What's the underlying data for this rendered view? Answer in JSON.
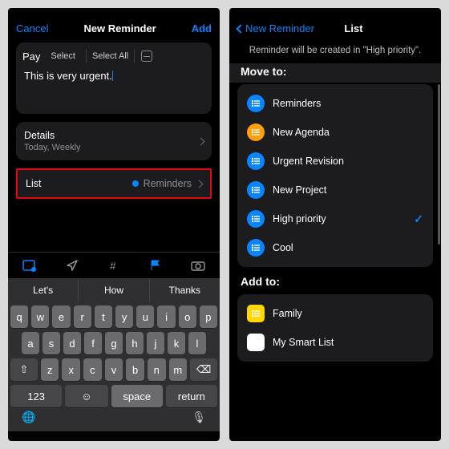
{
  "left": {
    "nav": {
      "cancel": "Cancel",
      "title": "New Reminder",
      "add": "Add"
    },
    "title_value": "Pay",
    "select": "Select",
    "select_all": "Select All",
    "body": "This is very urgent.",
    "details": {
      "label": "Details",
      "sub": "Today, Weekly"
    },
    "list": {
      "label": "List",
      "value": "Reminders"
    },
    "suggestions": [
      "Let's",
      "How",
      "Thanks"
    ],
    "rows": {
      "r1": [
        "q",
        "w",
        "e",
        "r",
        "t",
        "y",
        "u",
        "i",
        "o",
        "p"
      ],
      "r2": [
        "a",
        "s",
        "d",
        "f",
        "g",
        "h",
        "j",
        "k",
        "l"
      ],
      "r3": [
        "z",
        "x",
        "c",
        "v",
        "b",
        "n",
        "m"
      ]
    },
    "num_key": "123",
    "space": "space",
    "return": "return"
  },
  "right": {
    "back": "New Reminder",
    "title": "List",
    "info": "Reminder will be created in \"High priority\".",
    "move_h": "Move to:",
    "add_h": "Add to:",
    "move": [
      {
        "name": "Reminders",
        "color": "#0a84ff",
        "selected": false
      },
      {
        "name": "New Agenda",
        "color": "#ff9f0a",
        "selected": false
      },
      {
        "name": "Urgent Revision",
        "color": "#0a84ff",
        "selected": false
      },
      {
        "name": "New Project",
        "color": "#0a84ff",
        "selected": false
      },
      {
        "name": "High priority",
        "color": "#0a84ff",
        "selected": true
      },
      {
        "name": "Cool",
        "color": "#0a84ff",
        "selected": false
      }
    ],
    "add": [
      {
        "name": "Family",
        "color": "#ffd60a",
        "kind": "square"
      },
      {
        "name": "My Smart List",
        "color": "#ffffff",
        "kind": "square"
      }
    ]
  }
}
